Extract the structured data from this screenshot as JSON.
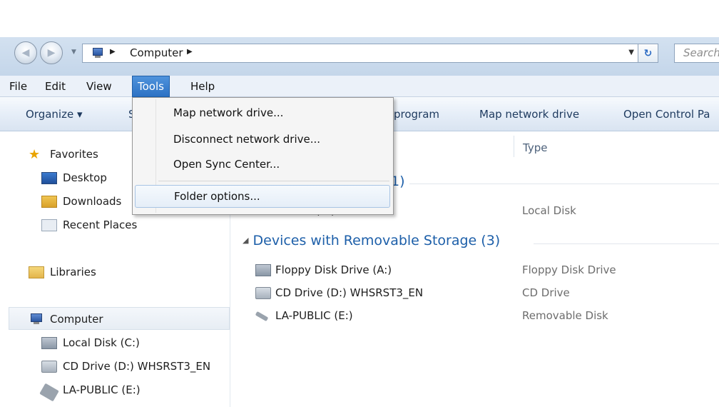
{
  "window": {
    "breadcrumb_computer": "Computer",
    "search_placeholder": "Search"
  },
  "menubar": {
    "items": [
      "File",
      "Edit",
      "View",
      "Tools",
      "Help"
    ],
    "active": "Tools"
  },
  "toolbar": {
    "organize": "Organize ▾",
    "system_properties_partial": "S",
    "uninstall_partial": "program",
    "map_network_drive": "Map network drive",
    "open_control_panel": "Open Control Pa"
  },
  "tools_menu": {
    "items": [
      "Map network drive...",
      "Disconnect network drive...",
      "Open Sync Center...",
      "Folder options..."
    ],
    "hovered": "Folder options..."
  },
  "nav": {
    "favorites": "Favorites",
    "desktop": "Desktop",
    "downloads": "Downloads",
    "recent_places": "Recent Places",
    "libraries": "Libraries",
    "computer": "Computer",
    "local_disk": "Local Disk (C:)",
    "cd_drive": "CD Drive (D:) WHSRST3_EN",
    "la_public": "LA-PUBLIC (E:)"
  },
  "content": {
    "type_header": "Type",
    "hdd_group_partial": "1)",
    "hdd_row_partial": "Local Disk (C:)",
    "hdd_type": "Local Disk",
    "removable_group": "Devices with Removable Storage (3)",
    "devices": [
      {
        "name": "Floppy Disk Drive (A:)",
        "type": "Floppy Disk Drive"
      },
      {
        "name": "CD Drive (D:) WHSRST3_EN",
        "type": "CD Drive"
      },
      {
        "name": "LA-PUBLIC (E:)",
        "type": "Removable Disk"
      }
    ]
  },
  "colors": {
    "menu_active": "#2d72c4",
    "group_text": "#1d5fa9"
  }
}
